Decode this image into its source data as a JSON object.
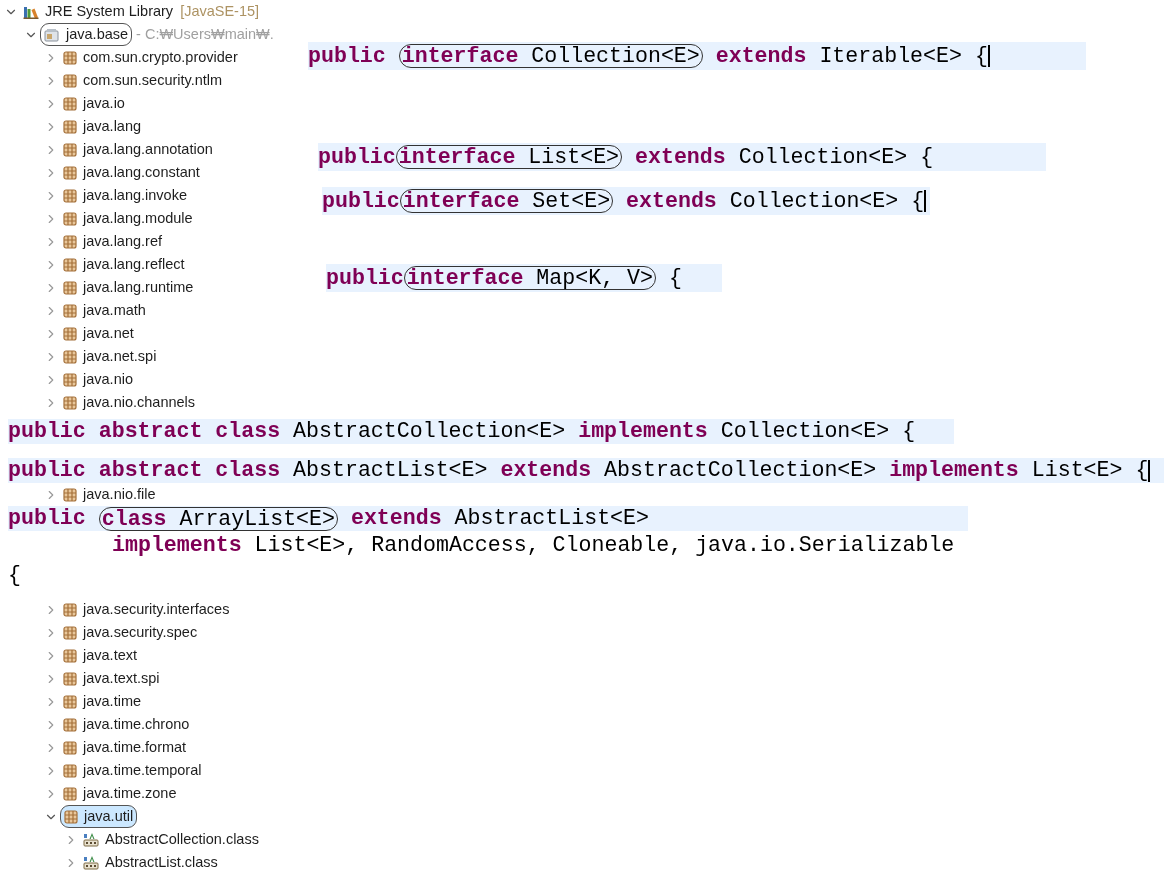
{
  "tree": [
    {
      "kind": "library",
      "label": "JRE System Library",
      "decoration": "[JavaSE-15]",
      "circled": false,
      "selected": false,
      "expanded": true,
      "children": [
        {
          "kind": "jar",
          "label": "java.base",
          "decoration": "- C:₩Users₩main₩.",
          "circled": true,
          "selected": false,
          "expanded": true,
          "children": [
            {
              "kind": "package",
              "label": "com.sun.crypto.provider",
              "circled": false,
              "selected": false,
              "expanded": false
            },
            {
              "kind": "package",
              "label": "com.sun.security.ntlm",
              "circled": false,
              "selected": false,
              "expanded": false
            },
            {
              "kind": "package",
              "label": "java.io",
              "circled": false,
              "selected": false,
              "expanded": false
            },
            {
              "kind": "package",
              "label": "java.lang",
              "circled": false,
              "selected": false,
              "expanded": false
            },
            {
              "kind": "package",
              "label": "java.lang.annotation",
              "circled": false,
              "selected": false,
              "expanded": false
            },
            {
              "kind": "package",
              "label": "java.lang.constant",
              "circled": false,
              "selected": false,
              "expanded": false
            },
            {
              "kind": "package",
              "label": "java.lang.invoke",
              "circled": false,
              "selected": false,
              "expanded": false
            },
            {
              "kind": "package",
              "label": "java.lang.module",
              "circled": false,
              "selected": false,
              "expanded": false
            },
            {
              "kind": "package",
              "label": "java.lang.ref",
              "circled": false,
              "selected": false,
              "expanded": false
            },
            {
              "kind": "package",
              "label": "java.lang.reflect",
              "circled": false,
              "selected": false,
              "expanded": false
            },
            {
              "kind": "package",
              "label": "java.lang.runtime",
              "circled": false,
              "selected": false,
              "expanded": false
            },
            {
              "kind": "package",
              "label": "java.math",
              "circled": false,
              "selected": false,
              "expanded": false
            },
            {
              "kind": "package",
              "label": "java.net",
              "circled": false,
              "selected": false,
              "expanded": false
            },
            {
              "kind": "package",
              "label": "java.net.spi",
              "circled": false,
              "selected": false,
              "expanded": false
            },
            {
              "kind": "package",
              "label": "java.nio",
              "circled": false,
              "selected": false,
              "expanded": false
            },
            {
              "kind": "package",
              "label": "java.nio.channels",
              "circled": false,
              "selected": false,
              "expanded": false
            }
          ]
        }
      ]
    }
  ],
  "top_code": [
    {
      "highlighted": true,
      "caret": true,
      "groups": [
        {
          "circled": false,
          "tokens": [
            {
              "kind": "keyword",
              "text": "public "
            }
          ]
        },
        {
          "circled": true,
          "tokens": [
            {
              "kind": "keyword",
              "text": "interface"
            },
            {
              "kind": "plain",
              "text": " Collection<E>"
            }
          ]
        },
        {
          "circled": false,
          "tokens": [
            {
              "kind": "keyword",
              "text": " extends"
            },
            {
              "kind": "plain",
              "text": " Iterable<E> {"
            }
          ]
        }
      ]
    },
    {
      "highlighted": true,
      "caret": false,
      "groups": [
        {
          "circled": false,
          "tokens": [
            {
              "kind": "keyword",
              "text": "public"
            }
          ]
        },
        {
          "circled": true,
          "tokens": [
            {
              "kind": "keyword",
              "text": "interface"
            },
            {
              "kind": "plain",
              "text": " List<E>"
            }
          ]
        },
        {
          "circled": false,
          "tokens": [
            {
              "kind": "keyword",
              "text": " extends"
            },
            {
              "kind": "plain",
              "text": " Collection<E> {"
            }
          ]
        }
      ]
    },
    {
      "highlighted": true,
      "caret": true,
      "groups": [
        {
          "circled": false,
          "tokens": [
            {
              "kind": "keyword",
              "text": "public"
            }
          ]
        },
        {
          "circled": true,
          "tokens": [
            {
              "kind": "keyword",
              "text": "interface"
            },
            {
              "kind": "plain",
              "text": " Set<E>"
            }
          ]
        },
        {
          "circled": false,
          "tokens": [
            {
              "kind": "keyword",
              "text": " extends"
            },
            {
              "kind": "plain",
              "text": " Collection<E> {"
            }
          ]
        }
      ]
    },
    {
      "highlighted": true,
      "caret": false,
      "groups": [
        {
          "circled": false,
          "tokens": [
            {
              "kind": "keyword",
              "text": "public"
            }
          ]
        },
        {
          "circled": true,
          "tokens": [
            {
              "kind": "keyword",
              "text": "interface"
            },
            {
              "kind": "plain",
              "text": " Map<K, V>"
            }
          ]
        },
        {
          "circled": false,
          "tokens": [
            {
              "kind": "plain",
              "text": " {"
            }
          ]
        }
      ]
    }
  ],
  "middle": [
    {
      "kind": "code",
      "highlighted": true,
      "caret": false,
      "groups": [
        {
          "circled": false,
          "tokens": [
            {
              "kind": "keyword",
              "text": "public abstract class"
            },
            {
              "kind": "plain",
              "text": " AbstractCollection<E> "
            },
            {
              "kind": "keyword",
              "text": "implements"
            },
            {
              "kind": "plain",
              "text": " Collection<E> {"
            }
          ]
        }
      ]
    },
    {
      "kind": "code",
      "highlighted": true,
      "caret": true,
      "groups": [
        {
          "circled": false,
          "tokens": [
            {
              "kind": "keyword",
              "text": "public abstract class"
            },
            {
              "kind": "plain",
              "text": " AbstractList<E> "
            },
            {
              "kind": "keyword",
              "text": "extends"
            },
            {
              "kind": "plain",
              "text": " AbstractCollection<E> "
            },
            {
              "kind": "keyword",
              "text": "implements"
            },
            {
              "kind": "plain",
              "text": " List<E> {"
            }
          ]
        }
      ]
    },
    {
      "kind": "tree_row",
      "item": {
        "kind": "package",
        "label": "java.nio.file",
        "circled": false,
        "selected": false,
        "expanded": false
      }
    },
    {
      "kind": "code",
      "highlighted": true,
      "caret": false,
      "groups": [
        {
          "circled": false,
          "tokens": [
            {
              "kind": "keyword",
              "text": "public "
            }
          ]
        },
        {
          "circled": true,
          "tokens": [
            {
              "kind": "keyword",
              "text": "class"
            },
            {
              "kind": "plain",
              "text": " ArrayList<E>"
            }
          ]
        },
        {
          "circled": false,
          "tokens": [
            {
              "kind": "keyword",
              "text": " extends"
            },
            {
              "kind": "plain",
              "text": " AbstractList<E>"
            }
          ]
        }
      ]
    },
    {
      "kind": "code",
      "highlighted": false,
      "caret": false,
      "groups": [
        {
          "circled": false,
          "tokens": [
            {
              "kind": "keyword",
              "text": "implements"
            },
            {
              "kind": "plain",
              "text": " List<E>, RandomAccess, Cloneable, java.io.Serializable"
            }
          ]
        }
      ]
    },
    {
      "kind": "code",
      "highlighted": false,
      "caret": false,
      "groups": [
        {
          "circled": false,
          "tokens": [
            {
              "kind": "plain",
              "text": "{"
            }
          ]
        }
      ]
    }
  ],
  "bottom_tree": [
    {
      "kind": "package",
      "label": "java.security.interfaces",
      "circled": false,
      "selected": false,
      "expanded": false
    },
    {
      "kind": "package",
      "label": "java.security.spec",
      "circled": false,
      "selected": false,
      "expanded": false
    },
    {
      "kind": "package",
      "label": "java.text",
      "circled": false,
      "selected": false,
      "expanded": false
    },
    {
      "kind": "package",
      "label": "java.text.spi",
      "circled": false,
      "selected": false,
      "expanded": false
    },
    {
      "kind": "package",
      "label": "java.time",
      "circled": false,
      "selected": false,
      "expanded": false
    },
    {
      "kind": "package",
      "label": "java.time.chrono",
      "circled": false,
      "selected": false,
      "expanded": false
    },
    {
      "kind": "package",
      "label": "java.time.format",
      "circled": false,
      "selected": false,
      "expanded": false
    },
    {
      "kind": "package",
      "label": "java.time.temporal",
      "circled": false,
      "selected": false,
      "expanded": false
    },
    {
      "kind": "package",
      "label": "java.time.zone",
      "circled": false,
      "selected": false,
      "expanded": false
    },
    {
      "kind": "package",
      "label": "java.util",
      "circled": true,
      "selected": true,
      "expanded": true,
      "children": [
        {
          "kind": "class",
          "label": "AbstractCollection.class",
          "circled": false,
          "selected": false,
          "expanded": false
        },
        {
          "kind": "class",
          "label": "AbstractList.class",
          "circled": false,
          "selected": false,
          "expanded": false
        }
      ]
    }
  ]
}
